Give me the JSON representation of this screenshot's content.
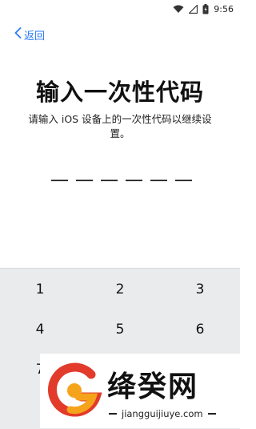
{
  "status_bar": {
    "time": "9:56",
    "icons": [
      "wifi-icon",
      "signal-icon",
      "battery-icon"
    ]
  },
  "nav": {
    "back_label": "返回",
    "back_icon": "chevron-left-icon"
  },
  "main": {
    "title": "输入一次性代码",
    "subtitle": "请输入 iOS 设备上的一次性代码以继续设置。",
    "code_length": 6
  },
  "keypad": {
    "keys": [
      "1",
      "2",
      "3",
      "4",
      "5",
      "6",
      "7"
    ]
  },
  "watermark": {
    "brand": "绛癸网",
    "url": "jiangguijiuye.com"
  },
  "colors": {
    "accent": "#2a7cf6",
    "keypad_bg": "#eaebed",
    "logo_red": "#e23b2b",
    "logo_orange": "#f5a31a"
  }
}
